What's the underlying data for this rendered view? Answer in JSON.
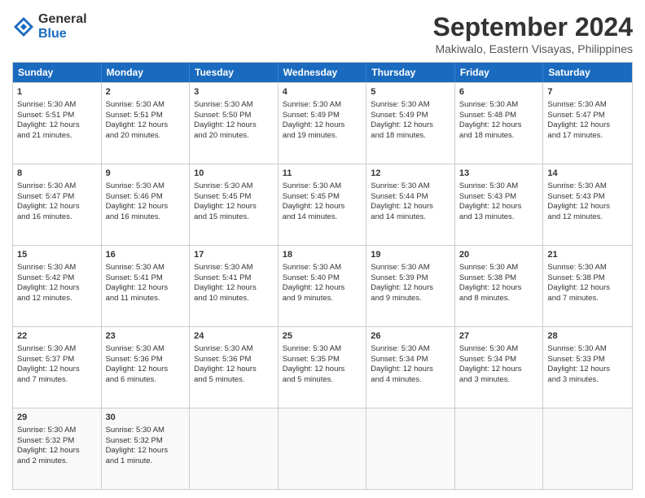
{
  "header": {
    "logo_general": "General",
    "logo_blue": "Blue",
    "month_title": "September 2024",
    "location": "Makiwalo, Eastern Visayas, Philippines"
  },
  "days_of_week": [
    "Sunday",
    "Monday",
    "Tuesday",
    "Wednesday",
    "Thursday",
    "Friday",
    "Saturday"
  ],
  "weeks": [
    [
      {
        "day": "1",
        "lines": [
          "Sunrise: 5:30 AM",
          "Sunset: 5:51 PM",
          "Daylight: 12 hours",
          "and 21 minutes."
        ]
      },
      {
        "day": "2",
        "lines": [
          "Sunrise: 5:30 AM",
          "Sunset: 5:51 PM",
          "Daylight: 12 hours",
          "and 20 minutes."
        ]
      },
      {
        "day": "3",
        "lines": [
          "Sunrise: 5:30 AM",
          "Sunset: 5:50 PM",
          "Daylight: 12 hours",
          "and 20 minutes."
        ]
      },
      {
        "day": "4",
        "lines": [
          "Sunrise: 5:30 AM",
          "Sunset: 5:49 PM",
          "Daylight: 12 hours",
          "and 19 minutes."
        ]
      },
      {
        "day": "5",
        "lines": [
          "Sunrise: 5:30 AM",
          "Sunset: 5:49 PM",
          "Daylight: 12 hours",
          "and 18 minutes."
        ]
      },
      {
        "day": "6",
        "lines": [
          "Sunrise: 5:30 AM",
          "Sunset: 5:48 PM",
          "Daylight: 12 hours",
          "and 18 minutes."
        ]
      },
      {
        "day": "7",
        "lines": [
          "Sunrise: 5:30 AM",
          "Sunset: 5:47 PM",
          "Daylight: 12 hours",
          "and 17 minutes."
        ]
      }
    ],
    [
      {
        "day": "8",
        "lines": [
          "Sunrise: 5:30 AM",
          "Sunset: 5:47 PM",
          "Daylight: 12 hours",
          "and 16 minutes."
        ]
      },
      {
        "day": "9",
        "lines": [
          "Sunrise: 5:30 AM",
          "Sunset: 5:46 PM",
          "Daylight: 12 hours",
          "and 16 minutes."
        ]
      },
      {
        "day": "10",
        "lines": [
          "Sunrise: 5:30 AM",
          "Sunset: 5:45 PM",
          "Daylight: 12 hours",
          "and 15 minutes."
        ]
      },
      {
        "day": "11",
        "lines": [
          "Sunrise: 5:30 AM",
          "Sunset: 5:45 PM",
          "Daylight: 12 hours",
          "and 14 minutes."
        ]
      },
      {
        "day": "12",
        "lines": [
          "Sunrise: 5:30 AM",
          "Sunset: 5:44 PM",
          "Daylight: 12 hours",
          "and 14 minutes."
        ]
      },
      {
        "day": "13",
        "lines": [
          "Sunrise: 5:30 AM",
          "Sunset: 5:43 PM",
          "Daylight: 12 hours",
          "and 13 minutes."
        ]
      },
      {
        "day": "14",
        "lines": [
          "Sunrise: 5:30 AM",
          "Sunset: 5:43 PM",
          "Daylight: 12 hours",
          "and 12 minutes."
        ]
      }
    ],
    [
      {
        "day": "15",
        "lines": [
          "Sunrise: 5:30 AM",
          "Sunset: 5:42 PM",
          "Daylight: 12 hours",
          "and 12 minutes."
        ]
      },
      {
        "day": "16",
        "lines": [
          "Sunrise: 5:30 AM",
          "Sunset: 5:41 PM",
          "Daylight: 12 hours",
          "and 11 minutes."
        ]
      },
      {
        "day": "17",
        "lines": [
          "Sunrise: 5:30 AM",
          "Sunset: 5:41 PM",
          "Daylight: 12 hours",
          "and 10 minutes."
        ]
      },
      {
        "day": "18",
        "lines": [
          "Sunrise: 5:30 AM",
          "Sunset: 5:40 PM",
          "Daylight: 12 hours",
          "and 9 minutes."
        ]
      },
      {
        "day": "19",
        "lines": [
          "Sunrise: 5:30 AM",
          "Sunset: 5:39 PM",
          "Daylight: 12 hours",
          "and 9 minutes."
        ]
      },
      {
        "day": "20",
        "lines": [
          "Sunrise: 5:30 AM",
          "Sunset: 5:38 PM",
          "Daylight: 12 hours",
          "and 8 minutes."
        ]
      },
      {
        "day": "21",
        "lines": [
          "Sunrise: 5:30 AM",
          "Sunset: 5:38 PM",
          "Daylight: 12 hours",
          "and 7 minutes."
        ]
      }
    ],
    [
      {
        "day": "22",
        "lines": [
          "Sunrise: 5:30 AM",
          "Sunset: 5:37 PM",
          "Daylight: 12 hours",
          "and 7 minutes."
        ]
      },
      {
        "day": "23",
        "lines": [
          "Sunrise: 5:30 AM",
          "Sunset: 5:36 PM",
          "Daylight: 12 hours",
          "and 6 minutes."
        ]
      },
      {
        "day": "24",
        "lines": [
          "Sunrise: 5:30 AM",
          "Sunset: 5:36 PM",
          "Daylight: 12 hours",
          "and 5 minutes."
        ]
      },
      {
        "day": "25",
        "lines": [
          "Sunrise: 5:30 AM",
          "Sunset: 5:35 PM",
          "Daylight: 12 hours",
          "and 5 minutes."
        ]
      },
      {
        "day": "26",
        "lines": [
          "Sunrise: 5:30 AM",
          "Sunset: 5:34 PM",
          "Daylight: 12 hours",
          "and 4 minutes."
        ]
      },
      {
        "day": "27",
        "lines": [
          "Sunrise: 5:30 AM",
          "Sunset: 5:34 PM",
          "Daylight: 12 hours",
          "and 3 minutes."
        ]
      },
      {
        "day": "28",
        "lines": [
          "Sunrise: 5:30 AM",
          "Sunset: 5:33 PM",
          "Daylight: 12 hours",
          "and 3 minutes."
        ]
      }
    ],
    [
      {
        "day": "29",
        "lines": [
          "Sunrise: 5:30 AM",
          "Sunset: 5:32 PM",
          "Daylight: 12 hours",
          "and 2 minutes."
        ]
      },
      {
        "day": "30",
        "lines": [
          "Sunrise: 5:30 AM",
          "Sunset: 5:32 PM",
          "Daylight: 12 hours",
          "and 1 minute."
        ]
      },
      {
        "day": "",
        "lines": []
      },
      {
        "day": "",
        "lines": []
      },
      {
        "day": "",
        "lines": []
      },
      {
        "day": "",
        "lines": []
      },
      {
        "day": "",
        "lines": []
      }
    ]
  ]
}
